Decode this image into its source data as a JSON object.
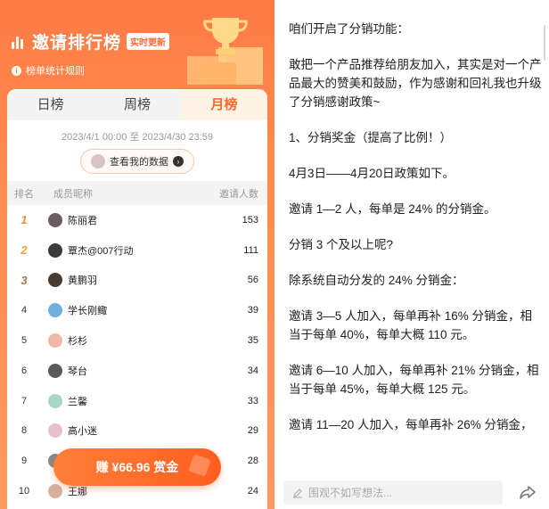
{
  "leaderboard": {
    "title": "邀请排行榜",
    "badge": "实时更新",
    "rules_link": "榜单统计规则",
    "tabs": [
      "日榜",
      "周榜",
      "月榜"
    ],
    "active_tab": "月榜",
    "date_range": "2023/4/1 00:00 至 2023/4/30 23:59",
    "view_my_data": "查看我的数据",
    "columns": {
      "rank": "排名",
      "name": "成员昵称",
      "count": "邀请人数"
    },
    "rows": [
      {
        "rank": "1",
        "name": "陈丽君",
        "count": "153",
        "avatar_color": "#6b5b63"
      },
      {
        "rank": "2",
        "name": "覃杰@007行动",
        "count": "111",
        "avatar_color": "#3b3b3b"
      },
      {
        "rank": "3",
        "name": "黄鹏羽",
        "count": "56",
        "avatar_color": "#4a3a30"
      },
      {
        "rank": "4",
        "name": "学长刚鲰",
        "count": "39",
        "avatar_color": "#6fb0e0"
      },
      {
        "rank": "5",
        "name": "杉杉",
        "count": "35",
        "avatar_color": "#f0b8a8"
      },
      {
        "rank": "6",
        "name": "琴台",
        "count": "34",
        "avatar_color": "#555a60"
      },
      {
        "rank": "7",
        "name": "兰馨",
        "count": "33",
        "avatar_color": "#a9d6c8"
      },
      {
        "rank": "8",
        "name": "高小迷",
        "count": "29",
        "avatar_color": "#e8c0c8"
      },
      {
        "rank": "9",
        "name": "",
        "count": "28",
        "avatar_color": "#888888"
      },
      {
        "rank": "10",
        "name": "王娜",
        "count": "24",
        "avatar_color": "#d8b0a0"
      }
    ],
    "earn_button": "赚 ¥66.96 赏金"
  },
  "article": {
    "paragraphs": [
      "咱们开启了分销功能：",
      "敢把一个产品推荐给朋友加入，其实是对一个产品最大的赞美和鼓励，作为感谢和回礼我也升级了分销感谢政策~",
      "1、分销奖金（提高了比例！）",
      "4月3日——4月20日政策如下。",
      "邀请 1—2 人，每单是 24% 的分销金。",
      "分销 3 个及以上呢?",
      "除系统自动分发的 24% 分销金：",
      "邀请 3—5 人加入，每单再补 16% 分销金，相当于每单 40%，每单大概 110 元。",
      "邀请 6—10 人加入，每单再补 21% 分销金，相当于每单 45%，每单大概 125 元。",
      "邀请 11—20 人加入，每单再补 26% 分销金，"
    ],
    "comment_placeholder": "围观不如写想法..."
  },
  "colors": {
    "accent": "#ff6a2a",
    "panel_bg": "#ff8a4f"
  },
  "icons": {
    "info": "info-icon",
    "pencil": "pencil-icon",
    "share": "share-icon",
    "trophy": "trophy-illustration"
  }
}
